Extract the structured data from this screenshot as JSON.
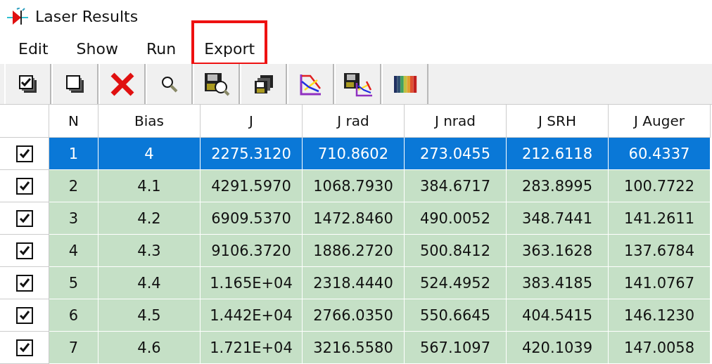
{
  "window": {
    "title": "Laser Results"
  },
  "menu": [
    {
      "label": "Edit",
      "highlighted": false
    },
    {
      "label": "Show",
      "highlighted": false
    },
    {
      "label": "Run",
      "highlighted": false
    },
    {
      "label": "Export",
      "highlighted": true
    }
  ],
  "toolbar": [
    {
      "kind": "check-all"
    },
    {
      "kind": "uncheck-all"
    },
    {
      "kind": "delete"
    },
    {
      "kind": "search"
    },
    {
      "kind": "save-search"
    },
    {
      "kind": "save-all"
    },
    {
      "kind": "plot"
    },
    {
      "kind": "save-plot"
    },
    {
      "kind": "spectrum"
    }
  ],
  "table": {
    "columns": [
      "N",
      "Bias",
      "J",
      "J rad",
      "J nrad",
      "J SRH",
      "J Auger"
    ],
    "rows": [
      {
        "checked": true,
        "selected": true,
        "cells": [
          "1",
          "4",
          "2275.3120",
          "710.8602",
          "273.0455",
          "212.6118",
          "60.4337"
        ]
      },
      {
        "checked": true,
        "selected": false,
        "cells": [
          "2",
          "4.1",
          "4291.5970",
          "1068.7930",
          "384.6717",
          "283.8995",
          "100.7722"
        ]
      },
      {
        "checked": true,
        "selected": false,
        "cells": [
          "3",
          "4.2",
          "6909.5370",
          "1472.8460",
          "490.0052",
          "348.7441",
          "141.2611"
        ]
      },
      {
        "checked": true,
        "selected": false,
        "cells": [
          "4",
          "4.3",
          "9106.3720",
          "1886.2720",
          "500.8412",
          "363.1628",
          "137.6784"
        ]
      },
      {
        "checked": true,
        "selected": false,
        "cells": [
          "5",
          "4.4",
          "1.165E+04",
          "2318.4440",
          "524.4952",
          "383.4185",
          "141.0767"
        ]
      },
      {
        "checked": true,
        "selected": false,
        "cells": [
          "6",
          "4.5",
          "1.442E+04",
          "2766.0350",
          "550.6645",
          "404.5415",
          "146.1230"
        ]
      },
      {
        "checked": true,
        "selected": false,
        "cells": [
          "7",
          "4.6",
          "1.721E+04",
          "3216.5580",
          "567.1097",
          "420.1039",
          "147.0058"
        ]
      }
    ]
  }
}
